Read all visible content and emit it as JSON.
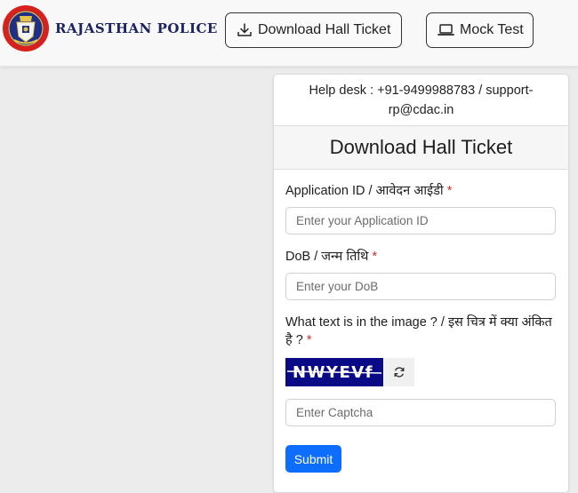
{
  "header": {
    "brand": "RAJASTHAN POLICE",
    "download_button_label": "Download Hall Ticket",
    "mock_test_button_label": "Mock Test",
    "download_icon": "download-icon",
    "mock_test_icon": "laptop-icon",
    "logo_icon": "rajasthan-police-emblem"
  },
  "card": {
    "helpdesk": "Help desk : +91-9499988783 / support-rp@cdac.in",
    "title": "Download Hall Ticket",
    "application_id": {
      "label": "Application ID / आवेदन आईडी",
      "placeholder": "Enter your Application ID",
      "value": ""
    },
    "dob": {
      "label": "DoB / जन्म तिथि",
      "placeholder": "Enter your DoB",
      "value": ""
    },
    "captcha": {
      "label": "What text is in the image ? / इस चित्र में क्या अंकित है ?",
      "image_text": "NWYEVf",
      "refresh_icon": "refresh-icon",
      "placeholder": "Enter Captcha",
      "value": ""
    },
    "required_marker": "*",
    "submit_label": "Submit"
  },
  "colors": {
    "brand_text": "#1b2363",
    "primary_button": "#0d6efd",
    "required": "#d32f2f",
    "captcha_bg": "#0a0a86"
  }
}
